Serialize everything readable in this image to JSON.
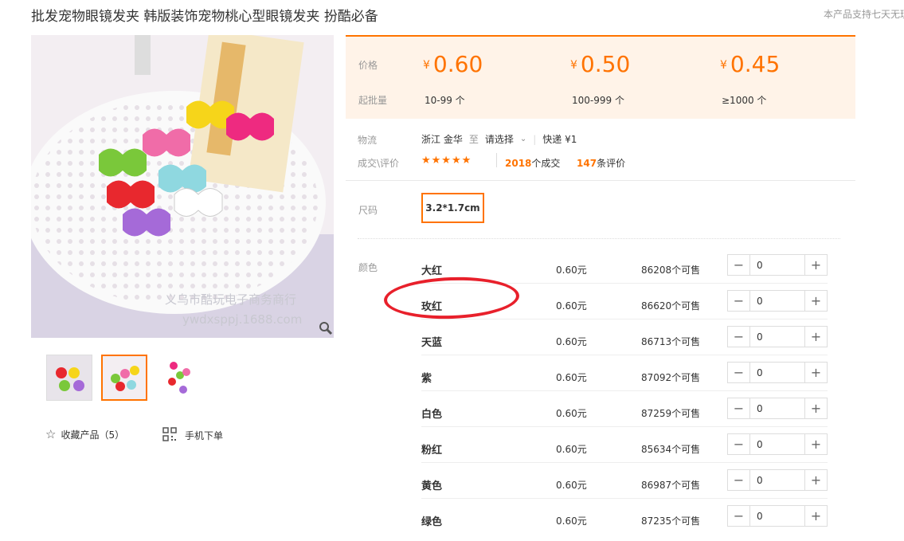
{
  "title": "批发宠物眼镜发夹 韩版装饰宠物桃心型眼镜发夹 扮酷必备",
  "right_note": "本产品支持七天无理",
  "watermark": {
    "line1": "义乌市酷玩电子商务商行",
    "line2": "ywdxsppj.1688.com"
  },
  "price_panel": {
    "price_label": "价格",
    "moq_label": "起批量",
    "currency": "¥",
    "tiers": [
      {
        "price": "0.60",
        "range": "10-99 个"
      },
      {
        "price": "0.50",
        "range": "100-999 个"
      },
      {
        "price": "0.45",
        "range": "≥1000 个"
      }
    ]
  },
  "logistics": {
    "label": "物流",
    "origin": "浙江 金华",
    "to": "至",
    "destination": "请选择",
    "method": "快递 ¥1"
  },
  "reviews": {
    "label": "成交\\评价",
    "stars": "★★★★★",
    "deals_count": "2018",
    "deals_suffix": "个成交",
    "reviews_count": "147",
    "reviews_suffix": "条评价"
  },
  "size": {
    "label": "尺码",
    "value": "3.2*1.7cm"
  },
  "colors": {
    "label": "颜色",
    "items": [
      {
        "name": "大红",
        "price": "0.60元",
        "stock": "86208个可售",
        "qty": "0"
      },
      {
        "name": "玫红",
        "price": "0.60元",
        "stock": "86620个可售",
        "qty": "0"
      },
      {
        "name": "天蓝",
        "price": "0.60元",
        "stock": "86713个可售",
        "qty": "0"
      },
      {
        "name": "紫",
        "price": "0.60元",
        "stock": "87092个可售",
        "qty": "0"
      },
      {
        "name": "白色",
        "price": "0.60元",
        "stock": "87259个可售",
        "qty": "0"
      },
      {
        "name": "粉红",
        "price": "0.60元",
        "stock": "85634个可售",
        "qty": "0"
      },
      {
        "name": "黄色",
        "price": "0.60元",
        "stock": "86987个可售",
        "qty": "0"
      },
      {
        "name": "绿色",
        "price": "0.60元",
        "stock": "87235个可售",
        "qty": "0"
      }
    ],
    "minus": "−",
    "plus": "+"
  },
  "actions": {
    "favorite": "收藏产品（5）",
    "mobile_order": "手机下单"
  },
  "accent": "#ff7300",
  "highlight": "#e8202b"
}
